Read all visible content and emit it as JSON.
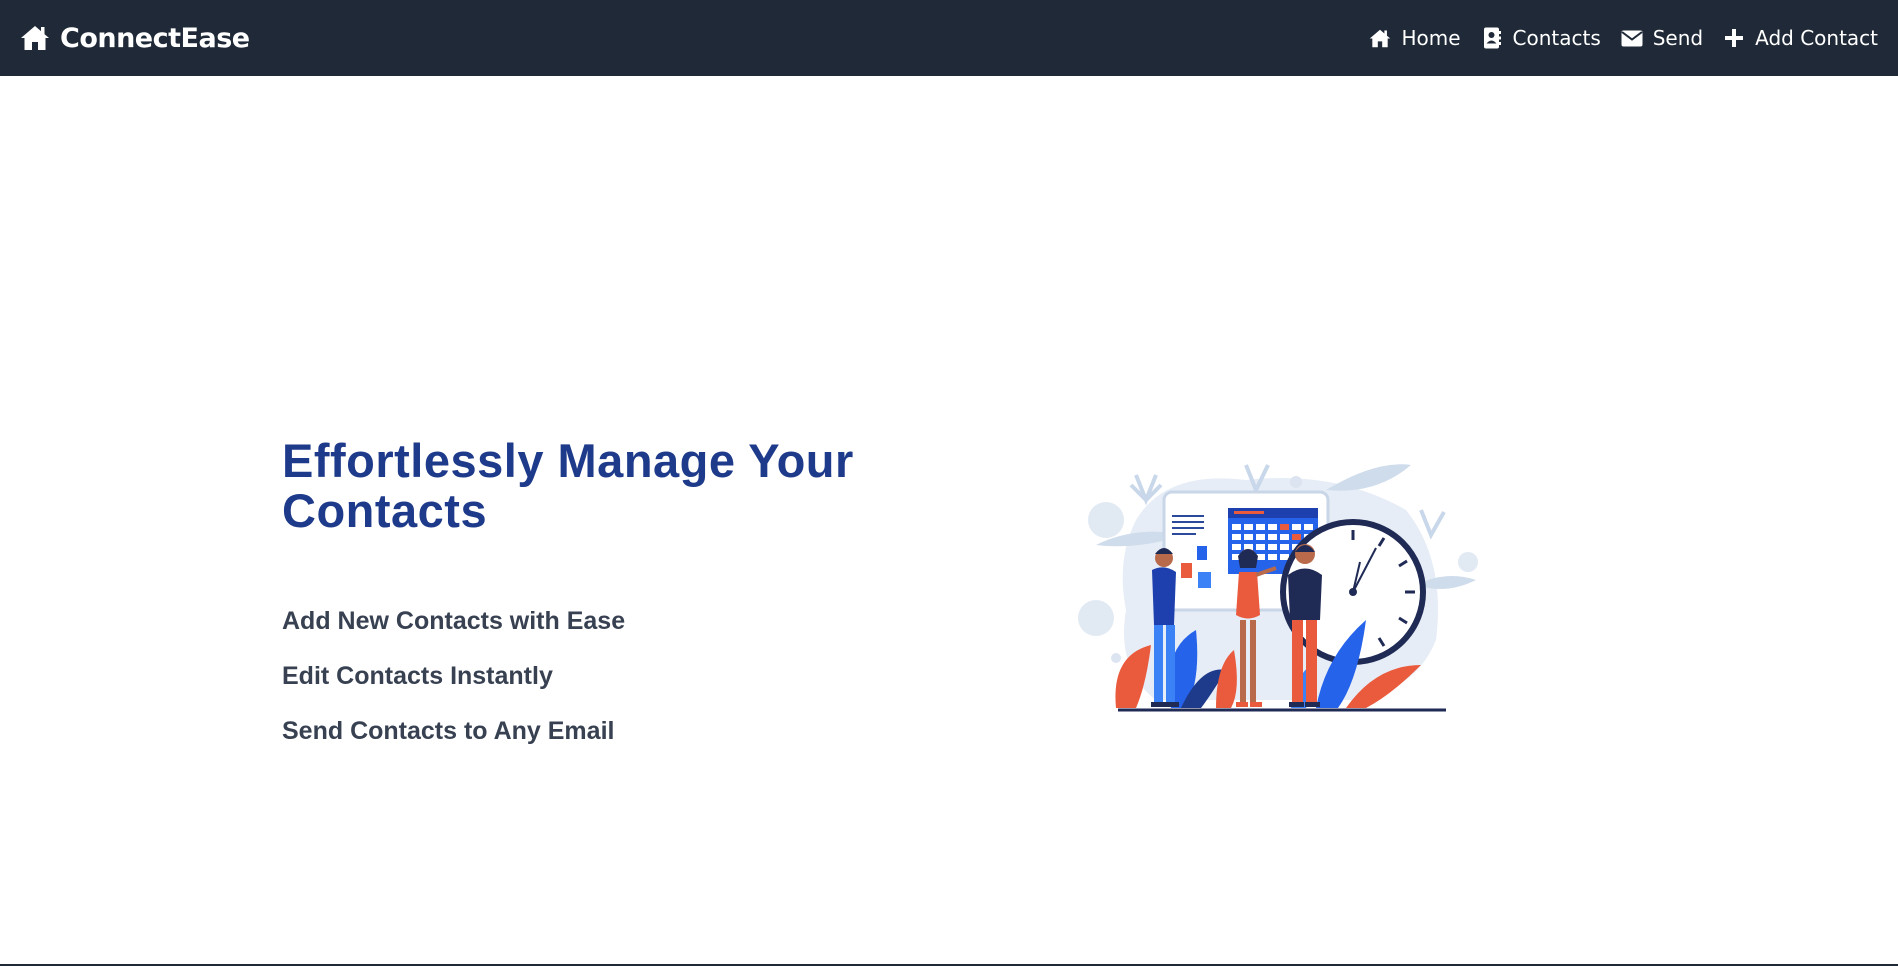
{
  "navbar": {
    "brand": {
      "icon": "home-icon",
      "name": "ConnectEase"
    },
    "links": [
      {
        "icon": "home-icon",
        "label": "Home"
      },
      {
        "icon": "contact-card-icon",
        "label": "Contacts"
      },
      {
        "icon": "envelope-icon",
        "label": "Send"
      },
      {
        "icon": "plus-icon",
        "label": "Add Contact"
      }
    ]
  },
  "hero": {
    "title": "Effortlessly Manage Your Contacts",
    "features": [
      "Add New Contacts with Ease",
      "Edit Contacts Instantly",
      "Send Contacts to Any Email"
    ]
  },
  "colors": {
    "navbar_bg": "#1f2937",
    "title": "#1e3a8a",
    "feature_text": "#374151",
    "accent_orange": "#ea5a3c",
    "accent_blue": "#2563eb"
  }
}
